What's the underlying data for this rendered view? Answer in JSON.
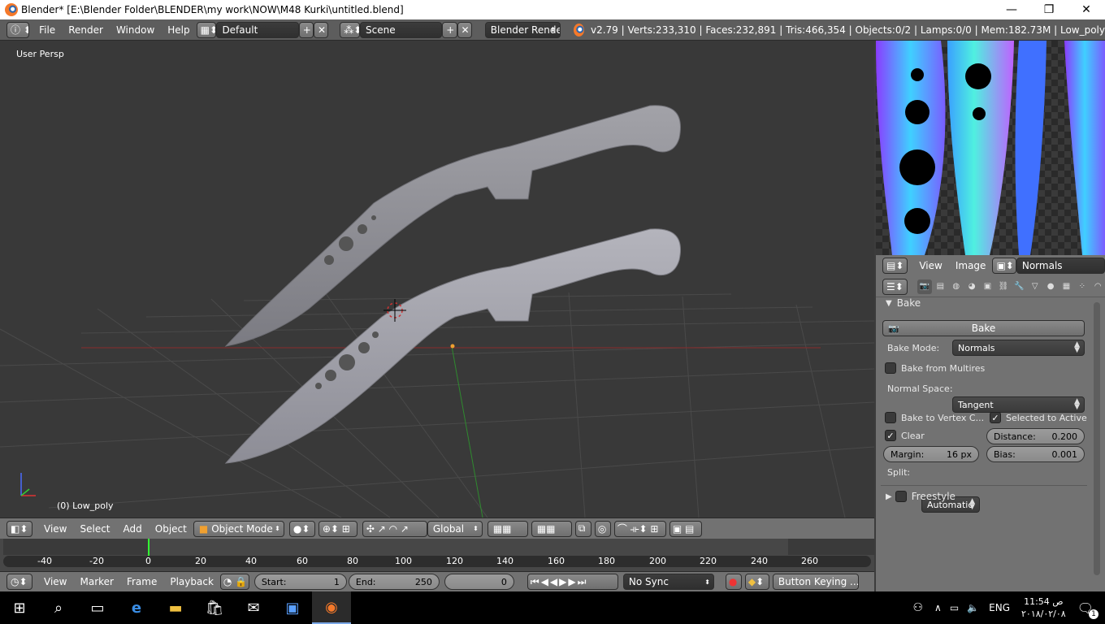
{
  "window": {
    "title": "Blender* [E:\\Blender Folder\\BLENDER\\my work\\NOW\\M48 Kurki\\untitled.blend]",
    "minimize": "—",
    "maximize": "❐",
    "close": "✕"
  },
  "infobar": {
    "menus": [
      "File",
      "Render",
      "Window",
      "Help"
    ],
    "layout": "Default",
    "scene": "Scene",
    "engine": "Blender Render",
    "stats": "v2.79 | Verts:233,310 | Faces:232,891 | Tris:466,354 | Objects:0/2 | Lamps:0/0 | Mem:182.73M | Low_poly"
  },
  "viewport": {
    "view_label": "User Persp",
    "object_label": "(0) Low_poly"
  },
  "viewport_header": {
    "menus": [
      "View",
      "Select",
      "Add",
      "Object"
    ],
    "mode": "Object Mode",
    "orientation": "Global"
  },
  "timeline": {
    "ticks": [
      "-40",
      "-20",
      "0",
      "20",
      "40",
      "60",
      "80",
      "100",
      "120",
      "140",
      "160",
      "180",
      "200",
      "220",
      "240",
      "260"
    ],
    "menus": [
      "View",
      "Marker",
      "Frame",
      "Playback"
    ],
    "start_label": "Start:",
    "start_value": "1",
    "end_label": "End:",
    "end_value": "250",
    "current_frame": "0",
    "sync": "No Sync",
    "keying": "Button Keying ..."
  },
  "uv_editor": {
    "menus": [
      "View",
      "Image"
    ],
    "image_name": "Normals"
  },
  "bake_panel": {
    "title": "Bake",
    "bake_button": "Bake",
    "bake_mode_label": "Bake Mode:",
    "bake_mode_value": "Normals",
    "bake_from_multires": "Bake from Multires",
    "normal_space_label": "Normal Space:",
    "normal_space_value": "Tangent",
    "bake_to_vertex": "Bake to Vertex C...",
    "selected_to_active": "Selected to Active",
    "clear": "Clear",
    "distance_label": "Distance:",
    "distance_value": "0.200",
    "margin_label": "Margin:",
    "margin_value": "16 px",
    "bias_label": "Bias:",
    "bias_value": "0.001",
    "split_label": "Split:",
    "split_value": "Automatic",
    "freestyle": "Freestyle"
  },
  "taskbar": {
    "language": "ENG",
    "time": "11:54 ص",
    "date": "٢٠١٨/٠٢/٠٨",
    "notifications": "1"
  }
}
